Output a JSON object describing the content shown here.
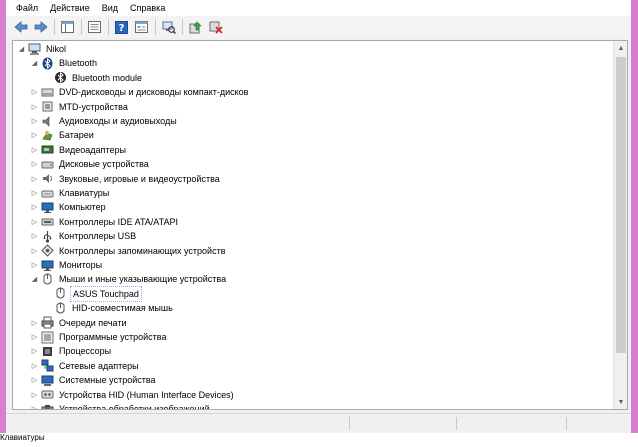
{
  "menu": [
    "Файл",
    "Действие",
    "Вид",
    "Справка"
  ],
  "toolbar_icons": [
    "back-arrow-icon",
    "forward-arrow-icon",
    "console-tree-icon",
    "properties-icon",
    "help-icon",
    "view-icon",
    "scan-hardware-icon",
    "update-driver-icon",
    "uninstall-device-icon"
  ],
  "tree": [
    {
      "label": "Nikol",
      "level": 0,
      "expander": "expanded",
      "icon": "computer-icon"
    },
    {
      "label": "Bluetooth",
      "level": 1,
      "expander": "expanded",
      "icon": "bluetooth-icon"
    },
    {
      "label": "Bluetooth module",
      "level": 2,
      "expander": "none",
      "icon": "bluetooth-device-icon"
    },
    {
      "label": "DVD-дисководы и дисководы компакт-дисков",
      "level": 1,
      "expander": "collapsed",
      "icon": "dvd-drive-icon"
    },
    {
      "label": "MTD-устройства",
      "level": 1,
      "expander": "collapsed",
      "icon": "mtd-device-icon"
    },
    {
      "label": "Аудиовходы и аудиовыходы",
      "level": 1,
      "expander": "collapsed",
      "icon": "speaker-icon"
    },
    {
      "label": "Батареи",
      "level": 1,
      "expander": "collapsed",
      "icon": "battery-icon"
    },
    {
      "label": "Видеоадаптеры",
      "level": 1,
      "expander": "collapsed",
      "icon": "display-adapter-icon"
    },
    {
      "label": "Дисковые устройства",
      "level": 1,
      "expander": "collapsed",
      "icon": "disk-drive-icon"
    },
    {
      "label": "Звуковые, игровые и видеоустройства",
      "level": 1,
      "expander": "collapsed",
      "icon": "sound-icon"
    },
    {
      "label": "Клавиатуры",
      "level": 1,
      "expander": "collapsed",
      "icon": "keyboard-icon"
    },
    {
      "label": "Компьютер",
      "level": 1,
      "expander": "collapsed",
      "icon": "monitor-icon"
    },
    {
      "label": "Контроллеры IDE ATA/ATAPI",
      "level": 1,
      "expander": "collapsed",
      "icon": "ide-controller-icon"
    },
    {
      "label": "Контроллеры USB",
      "level": 1,
      "expander": "collapsed",
      "icon": "usb-icon"
    },
    {
      "label": "Контроллеры запоминающих устройств",
      "level": 1,
      "expander": "collapsed",
      "icon": "storage-controller-icon"
    },
    {
      "label": "Мониторы",
      "level": 1,
      "expander": "collapsed",
      "icon": "monitor-icon"
    },
    {
      "label": "Мыши и иные указывающие устройства",
      "level": 1,
      "expander": "expanded",
      "icon": "mouse-icon"
    },
    {
      "label": "ASUS Touchpad",
      "level": 2,
      "expander": "none",
      "icon": "mouse-icon",
      "selected": true
    },
    {
      "label": "HID-совместимая мышь",
      "level": 2,
      "expander": "none",
      "icon": "mouse-icon"
    },
    {
      "label": "Очереди печати",
      "level": 1,
      "expander": "collapsed",
      "icon": "printer-icon"
    },
    {
      "label": "Программные устройства",
      "level": 1,
      "expander": "collapsed",
      "icon": "software-device-icon"
    },
    {
      "label": "Процессоры",
      "level": 1,
      "expander": "collapsed",
      "icon": "processor-icon"
    },
    {
      "label": "Сетевые адаптеры",
      "level": 1,
      "expander": "collapsed",
      "icon": "network-adapter-icon"
    },
    {
      "label": "Системные устройства",
      "level": 1,
      "expander": "collapsed",
      "icon": "system-device-icon"
    },
    {
      "label": "Устройства HID (Human Interface Devices)",
      "level": 1,
      "expander": "collapsed",
      "icon": "hid-icon"
    },
    {
      "label": "Устройства обработки изображений",
      "level": 1,
      "expander": "collapsed",
      "icon": "camera-icon"
    }
  ],
  "bottom_tip": "Клавиатуры",
  "colors": {
    "frame": "#d67ed0",
    "window": "#f0f0f0",
    "selection_border": "#8ab4e6"
  }
}
